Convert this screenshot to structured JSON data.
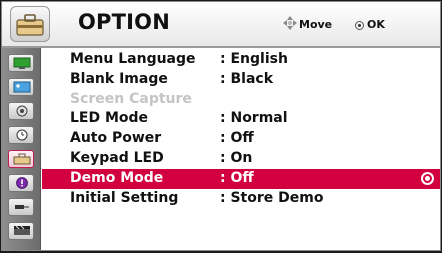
{
  "header": {
    "title": "OPTION",
    "icon": "option-toolbox-icon",
    "hints": [
      {
        "icon": "four-way-arrows-icon",
        "label": "Move"
      },
      {
        "icon": "ok-button-icon",
        "label": "OK"
      }
    ]
  },
  "sidebar": {
    "items": [
      {
        "icon": "picture-icon",
        "active": false
      },
      {
        "icon": "screen-icon",
        "active": false
      },
      {
        "icon": "audio-icon",
        "active": false
      },
      {
        "icon": "time-icon",
        "active": false
      },
      {
        "icon": "option-toolbox-icon",
        "active": true
      },
      {
        "icon": "info-icon",
        "active": false
      },
      {
        "icon": "input-icon",
        "active": false
      },
      {
        "icon": "3d-glasses-icon",
        "active": false
      }
    ]
  },
  "menu": {
    "items": [
      {
        "label": "Menu Language",
        "value": ": English",
        "state": "normal"
      },
      {
        "label": "Blank Image",
        "value": ": Black",
        "state": "normal"
      },
      {
        "label": "Screen Capture",
        "value": "",
        "state": "disabled"
      },
      {
        "label": "LED Mode",
        "value": ": Normal",
        "state": "normal"
      },
      {
        "label": "Auto Power",
        "value": ": Off",
        "state": "normal"
      },
      {
        "label": "Keypad LED",
        "value": ": On",
        "state": "normal"
      },
      {
        "label": "Demo Mode",
        "value": ": Off",
        "state": "selected"
      },
      {
        "label": "Initial Setting",
        "value": ": Store Demo",
        "state": "normal"
      }
    ]
  },
  "colors": {
    "highlight": "#d2003f",
    "disabled_text": "#c4c4c4",
    "sidebar": "#7c7c7c"
  }
}
